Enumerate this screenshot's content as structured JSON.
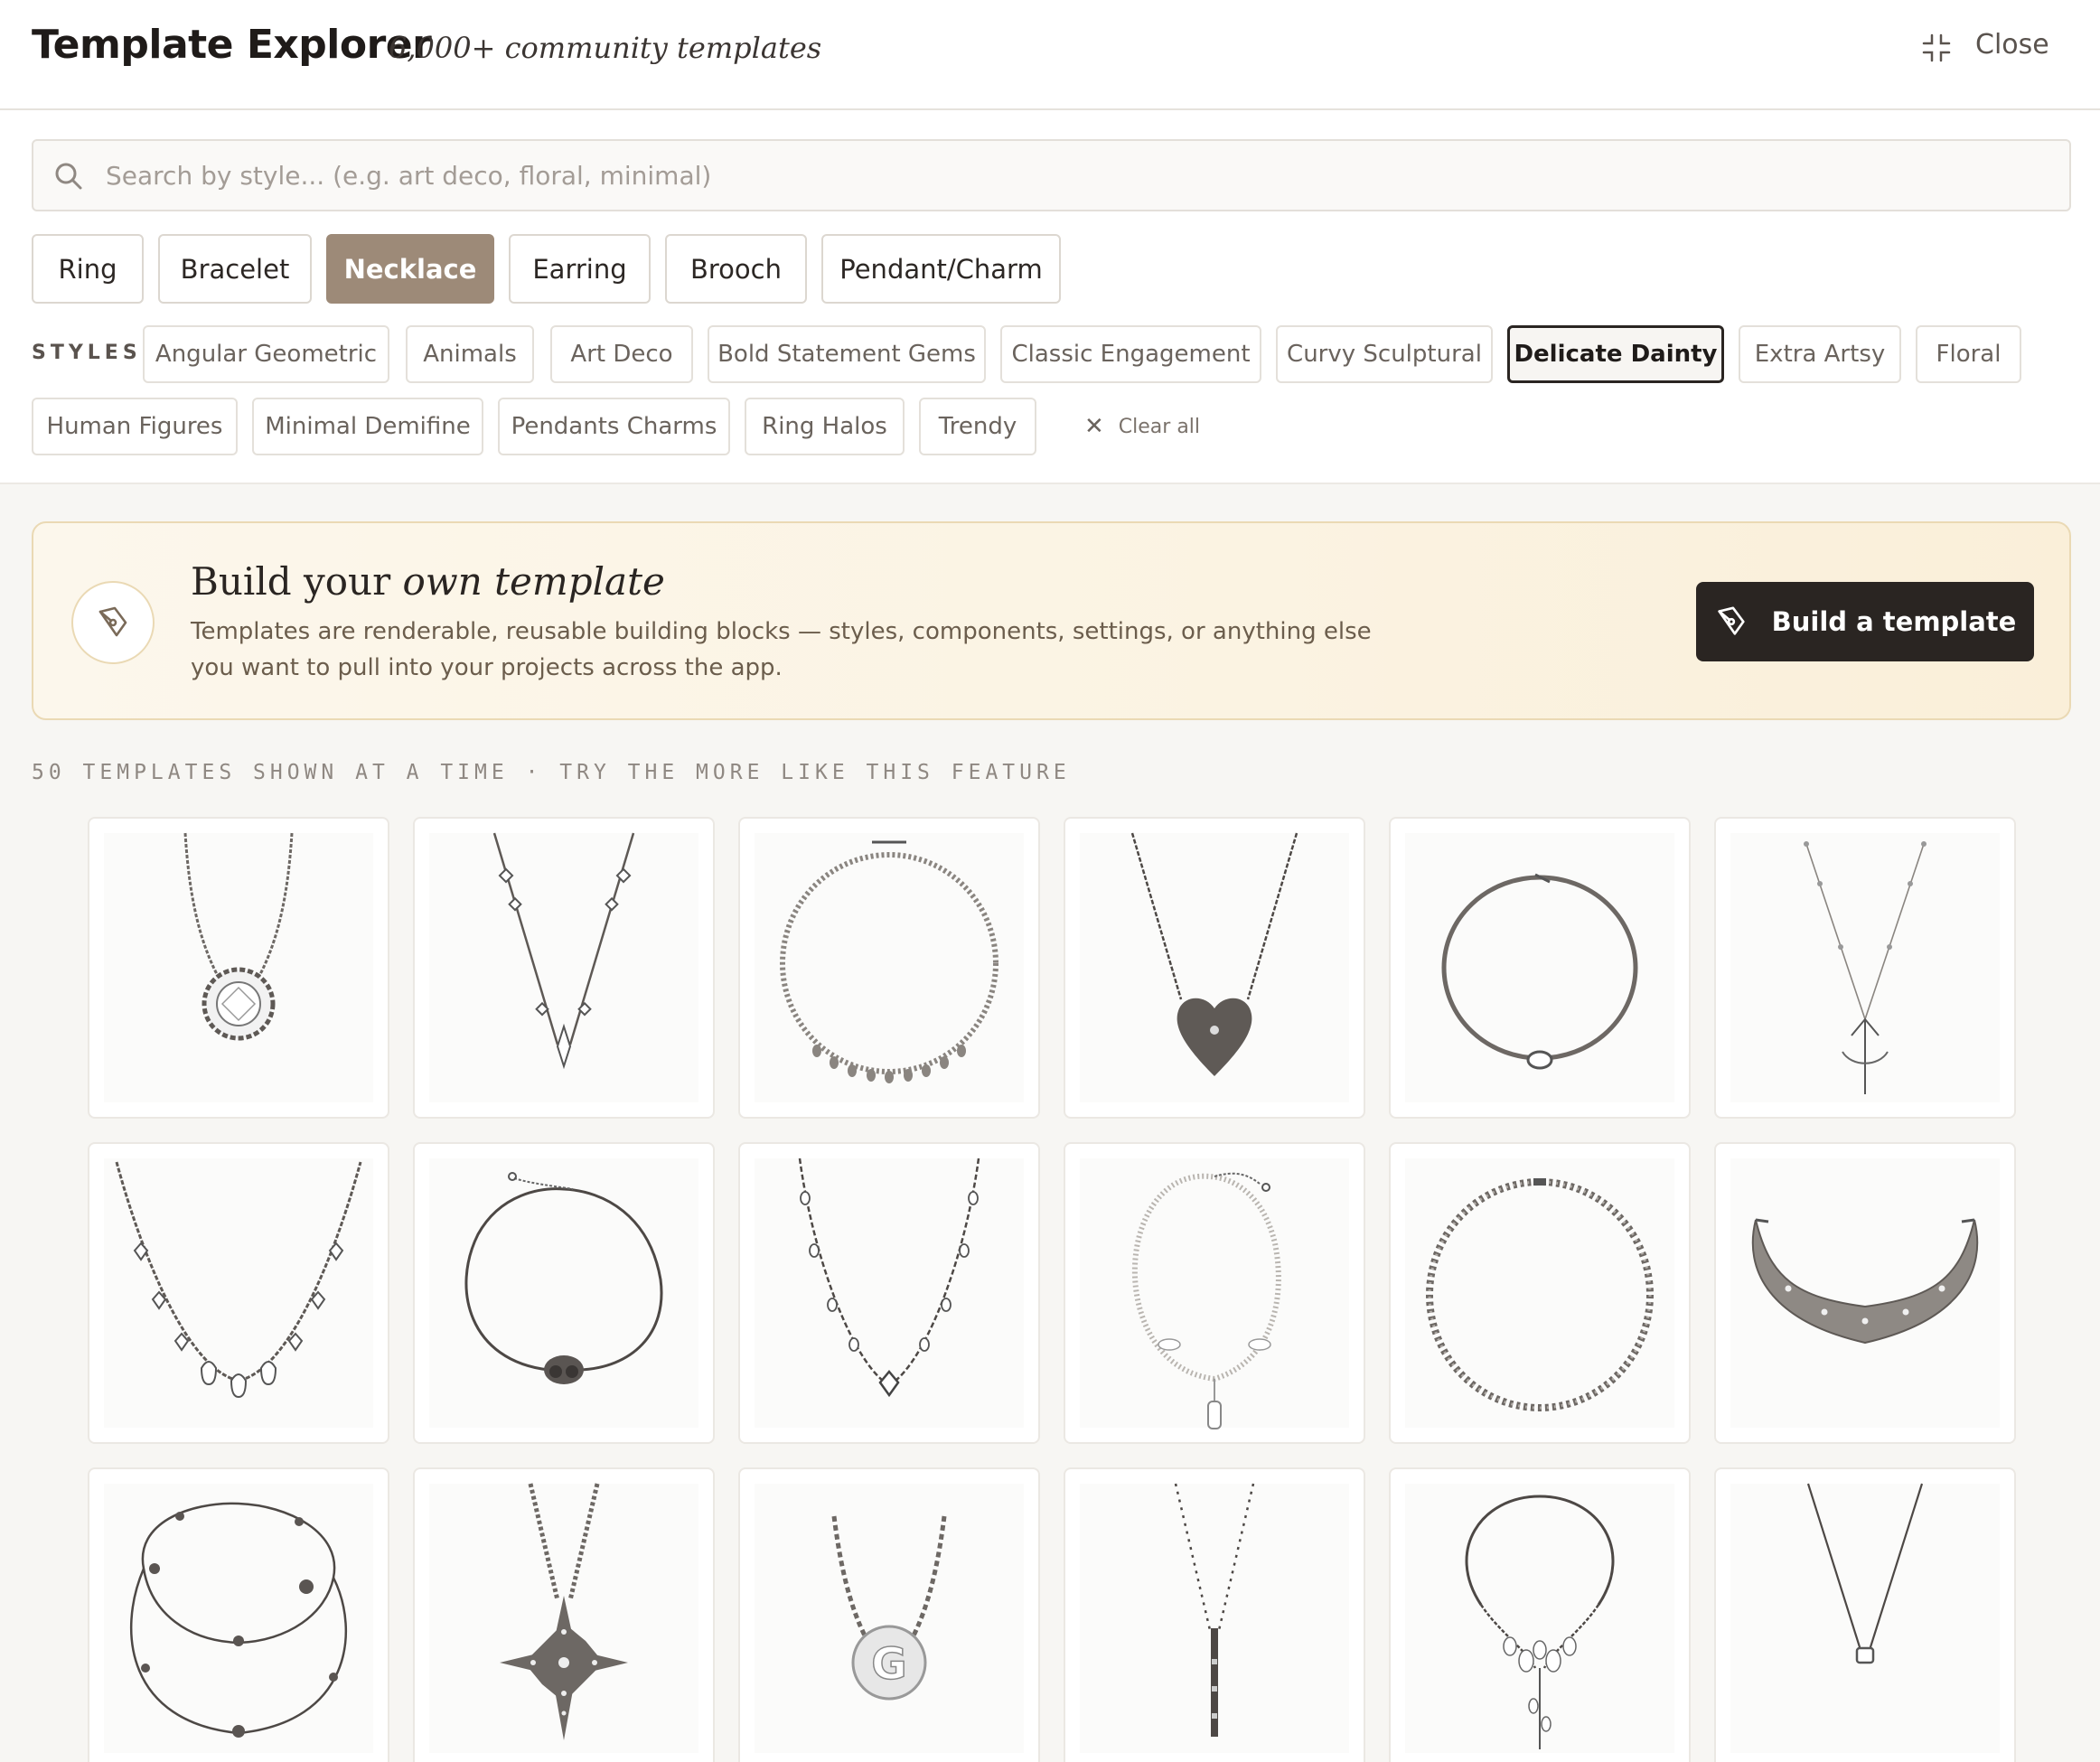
{
  "header": {
    "title": "Template Explorer",
    "subtitle": "6,000+ community templates",
    "close_label": "Close"
  },
  "search": {
    "placeholder": "Search by style... (e.g. art deco, floral, minimal)",
    "value": ""
  },
  "categories": [
    {
      "label": "Ring",
      "active": false
    },
    {
      "label": "Bracelet",
      "active": false
    },
    {
      "label": "Necklace",
      "active": true
    },
    {
      "label": "Earring",
      "active": false
    },
    {
      "label": "Brooch",
      "active": false
    },
    {
      "label": "Pendant/Charm",
      "active": false
    }
  ],
  "styles": {
    "label": "STYLES",
    "items": [
      {
        "label": "Angular Geometric",
        "active": false
      },
      {
        "label": "Animals",
        "active": false
      },
      {
        "label": "Art Deco",
        "active": false
      },
      {
        "label": "Bold Statement Gems",
        "active": false
      },
      {
        "label": "Classic Engagement",
        "active": false
      },
      {
        "label": "Curvy Sculptural",
        "active": false
      },
      {
        "label": "Delicate Dainty",
        "active": true
      },
      {
        "label": "Extra Artsy",
        "active": false
      },
      {
        "label": "Floral",
        "active": false
      },
      {
        "label": "Human Figures",
        "active": false
      },
      {
        "label": "Minimal Demifine",
        "active": false
      },
      {
        "label": "Pendants Charms",
        "active": false
      },
      {
        "label": "Ring Halos",
        "active": false
      },
      {
        "label": "Trendy",
        "active": false
      }
    ],
    "clear_label": "Clear all"
  },
  "banner": {
    "title_plain": "Build your",
    "title_italic": "own template",
    "description": "Templates are renderable, reusable building blocks — styles, components, settings, or anything else you want to pull into your projects across the app.",
    "button_label": "Build a template"
  },
  "count_note": "50 TEMPLATES SHOWN AT A TIME · TRY THE MORE LIKE THIS FEATURE",
  "templates": [
    {
      "kind": "halo-pendant"
    },
    {
      "kind": "star-station"
    },
    {
      "kind": "beaded-collar-drops"
    },
    {
      "kind": "heart-pendant"
    },
    {
      "kind": "wire-torque"
    },
    {
      "kind": "arrow-lariat"
    },
    {
      "kind": "gem-drops"
    },
    {
      "kind": "owl-choker"
    },
    {
      "kind": "station-teardrops"
    },
    {
      "kind": "pearl-fish"
    },
    {
      "kind": "beaded-rope"
    },
    {
      "kind": "mesh-collar"
    },
    {
      "kind": "double-strand"
    },
    {
      "kind": "starburst"
    },
    {
      "kind": "initial-g"
    },
    {
      "kind": "y-bar"
    },
    {
      "kind": "floral-drop"
    },
    {
      "kind": "solitaire"
    }
  ],
  "colors": {
    "accent": "#9d8a78",
    "dark_button": "#2a2522",
    "banner_border": "#ead9b4"
  }
}
